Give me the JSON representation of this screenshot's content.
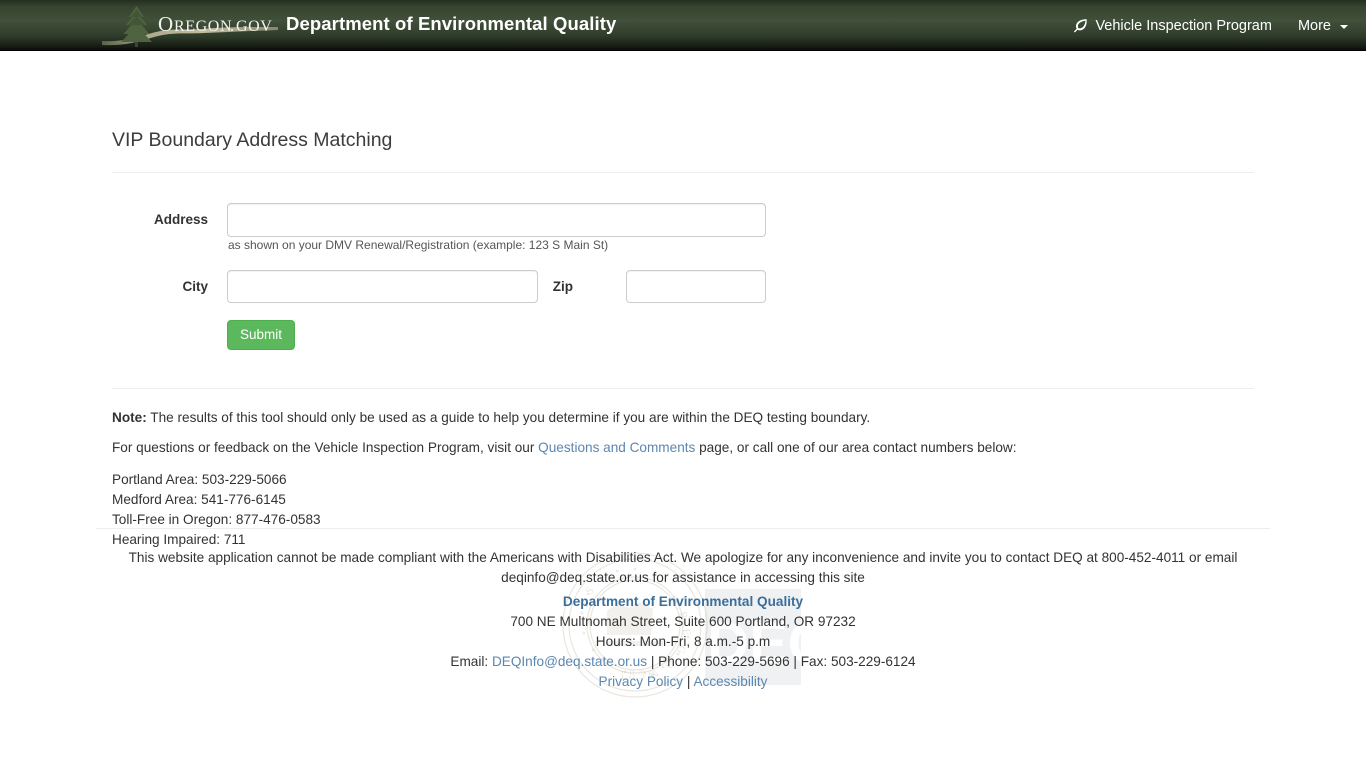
{
  "header": {
    "logo_text": "OREGON.GOV",
    "logo_name": "oregon-gov-logo",
    "site_title": "Department of Environmental Quality",
    "nav": [
      {
        "label": "Vehicle Inspection Program",
        "icon": "leaf-icon"
      },
      {
        "label": "More",
        "icon": "chevron-down-icon"
      }
    ]
  },
  "main": {
    "page_title": "VIP Boundary Address Matching",
    "form": {
      "address_label": "Address",
      "address_value": "",
      "address_placeholder": "",
      "address_help": "as shown on your DMV Renewal/Registration (example: 123 S Main St)",
      "city_label": "City",
      "city_value": "",
      "city_placeholder": "",
      "zip_label": "Zip",
      "zip_value": "",
      "zip_placeholder": "",
      "submit_label": "Submit"
    },
    "note": {
      "prefix": "Note:",
      "text": " The results of this tool should only be used as a guide to help you determine if you are within the DEQ testing boundary."
    },
    "contact_intro": {
      "before_link": "For questions or feedback on the Vehicle Inspection Program, visit our ",
      "link_text": "Questions and Comments",
      "after_link": " page, or call one of our area contact numbers below:"
    },
    "phone_lines": [
      "Portland Area: 503-229-5066",
      "Medford Area: 541-776-6145",
      "Toll-Free in Oregon: 877-476-0583",
      "Hearing Impaired: 711"
    ]
  },
  "footer": {
    "ada_line1": "This website application cannot be made compliant with the Americans with Disabilities Act. We apologize for any inconvenience and invite you to contact DEQ at 800-452-4011 or email",
    "ada_line2": "deqinfo@deq.state.or.us for assistance in accessing this site",
    "dept_name": "Department of Environmental Quality",
    "address": "700 NE Multnomah Street, Suite 600 Portland, OR 97232",
    "hours": "Hours: Mon-Fri, 8 a.m.-5 p.m",
    "email_label": "Email: ",
    "email_link": "DEQInfo@deq.state.or.us",
    "phone_fax": " | Phone: 503-229-5696 | Fax: 503-229-6124",
    "privacy_link": "Privacy Policy",
    "links_separator": " | ",
    "accessibility_link": "Accessibility",
    "watermark": "Oregon State Seal / DEQ"
  },
  "colors": {
    "header_green": "#41503a",
    "submit_green": "#5cb85c",
    "link_blue": "#5b87b0",
    "dept_blue": "#3b6e99",
    "text_dark": "#333333"
  }
}
